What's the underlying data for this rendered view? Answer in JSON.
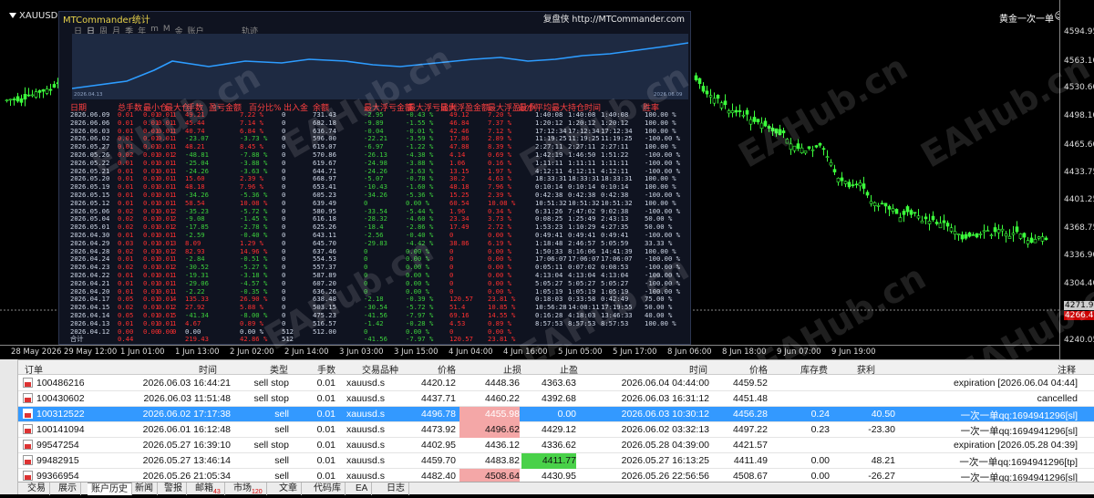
{
  "chart": {
    "symbol": "XAUUSD.s",
    "chart_name": "黄金一次一单",
    "prices": [
      "4594.95",
      "4563.10",
      "4530.60",
      "4498.10",
      "4465.60",
      "4433.75",
      "4401.25",
      "4368.75",
      "4336.90",
      "4304.40",
      "4266.45",
      "4240.05"
    ],
    "current_price": "4271.90",
    "bid_price": "4266.45",
    "times": [
      "28 May 2026",
      "29 May 12:00",
      "1 Jun 01:00",
      "1 Jun 13:00",
      "2 Jun 02:00",
      "2 Jun 14:00",
      "3 Jun 03:00",
      "3 Jun 15:00",
      "4 Jun 04:00",
      "4 Jun 16:00",
      "5 Jun 05:00",
      "5 Jun 17:00",
      "8 Jun 06:00",
      "8 Jun 18:00",
      "9 Jun 07:00",
      "9 Jun 19:00"
    ],
    "watermark": "EAHub.cn"
  },
  "panel": {
    "title": "MTCommander统计",
    "link": "复盘侠 http://MTCommander.com",
    "tabs": [
      "日",
      "日",
      "周",
      "月",
      "季",
      "年",
      "m",
      "M",
      "金",
      "账户"
    ],
    "track_label": "轨迹",
    "equity_start_date": "2026.04.13",
    "equity_end_date": "2026.06.09",
    "headers": [
      "日期",
      "总手数",
      "最小仓",
      "最大仓",
      "手数",
      "盈亏金额",
      "百分比%",
      "出入金",
      "余额",
      "最大浮亏金额",
      "最大浮亏比例",
      "最大浮盈金额",
      "最大浮盈比例",
      "最小平均最大持仓时间",
      "胜率"
    ],
    "rows": [
      [
        "2026.06.09",
        "0.01",
        "0.01",
        "0.01",
        "1",
        "49.21",
        "7.22 %",
        "0",
        "731.43",
        "-2.95",
        "-0.43 %",
        "49.12",
        "7.20 %",
        "1:40:08",
        "1:40:08",
        "1:40:08",
        "100.00 %"
      ],
      [
        "2026.06.06",
        "0.01",
        "0.01",
        "0.01",
        "1",
        "45.44",
        "7.14 %",
        "0",
        "682.18",
        "-9.89",
        "-1.55 %",
        "46.84",
        "7.37 %",
        "1:20:12",
        "1:20:12",
        "1:20:12",
        "100.00 %"
      ],
      [
        "2026.06.03",
        "0.01",
        "0.01",
        "0.01",
        "1",
        "40.74",
        "6.84 %",
        "0",
        "636.74",
        "-0.04",
        "-0.01 %",
        "42.46",
        "7.12 %",
        "17:12:34",
        "17:12:34",
        "17:12:34",
        "100.00 %"
      ],
      [
        "2026.06.02",
        "0.01",
        "0.01",
        "0.01",
        "1",
        "-23.07",
        "-3.73 %",
        "0",
        "596.00",
        "-22.21",
        "-3.59 %",
        "17.86",
        "2.89 %",
        "11:19:25",
        "11:19:25",
        "11:19:25",
        "-100.00 %"
      ],
      [
        "2026.05.27",
        "0.01",
        "0.01",
        "0.01",
        "1",
        "48.21",
        "8.45 %",
        "0",
        "619.07",
        "-6.97",
        "-1.22 %",
        "47.88",
        "8.39 %",
        "2:27:11",
        "2:27:11",
        "2:27:11",
        "100.00 %"
      ],
      [
        "2026.05.26",
        "0.02",
        "0.01",
        "0.01",
        "2",
        "-48.81",
        "-7.88 %",
        "0",
        "570.86",
        "-26.13",
        "-4.38 %",
        "4.14",
        "0.69 %",
        "1:42:19",
        "1:46:50",
        "1:51:22",
        "-100.00 %"
      ],
      [
        "2026.05.22",
        "0.01",
        "0.01",
        "0.01",
        "1",
        "-25.04",
        "-3.88 %",
        "0",
        "619.67",
        "-24.98",
        "-3.88 %",
        "1.06",
        "0.16 %",
        "1:11:11",
        "1:11:11",
        "1:11:11",
        "-100.00 %"
      ],
      [
        "2026.05.21",
        "0.01",
        "0.01",
        "0.01",
        "1",
        "-24.26",
        "-3.63 %",
        "0",
        "644.71",
        "-24.26",
        "-3.63 %",
        "13.15",
        "1.97 %",
        "4:12:11",
        "4:12:11",
        "4:12:11",
        "-100.00 %"
      ],
      [
        "2026.05.20",
        "0.01",
        "0.01",
        "0.01",
        "1",
        "15.60",
        "2.39 %",
        "0",
        "668.97",
        "-5.07",
        "-0.78 %",
        "30.2",
        "4.63 %",
        "18:33:31",
        "18:33:31",
        "18:33:31",
        "100.00 %"
      ],
      [
        "2026.05.19",
        "0.01",
        "0.01",
        "0.01",
        "1",
        "48.18",
        "7.96 %",
        "0",
        "653.41",
        "-10.43",
        "-1.60 %",
        "48.18",
        "7.96 %",
        "0:10:14",
        "0:10:14",
        "0:10:14",
        "100.00 %"
      ],
      [
        "2026.05.15",
        "0.01",
        "0.01",
        "0.01",
        "1",
        "-34.26",
        "-5.36 %",
        "0",
        "605.23",
        "-34.26",
        "-5.36 %",
        "15.25",
        "2.39 %",
        "0:42:38",
        "0:42:38",
        "0:42:38",
        "-100.00 %"
      ],
      [
        "2026.05.12",
        "0.01",
        "0.01",
        "0.01",
        "1",
        "58.54",
        "10.08 %",
        "0",
        "639.49",
        "0",
        "0.00 %",
        "60.54",
        "10.08 %",
        "10:51:32",
        "10:51:32",
        "10:51:32",
        "100.00 %"
      ],
      [
        "2026.05.06",
        "0.02",
        "0.01",
        "0.01",
        "2",
        "-35.23",
        "-5.72 %",
        "0",
        "580.95",
        "-33.54",
        "-5.44 %",
        "1.96",
        "0.34 %",
        "6:31:26",
        "7:47:02",
        "9:02:38",
        "-100.00 %"
      ],
      [
        "2026.05.04",
        "0.02",
        "0.01",
        "0.01",
        "2",
        "-9.08",
        "-1.45 %",
        "0",
        "616.18",
        "-28.32",
        "-4.60 %",
        "23.34",
        "3.73 %",
        "0:08:25",
        "1:25:49",
        "2:43:13",
        "50.00 %"
      ],
      [
        "2026.05.01",
        "0.02",
        "0.01",
        "0.01",
        "2",
        "-17.85",
        "-2.78 %",
        "0",
        "625.26",
        "-18.4",
        "-2.86 %",
        "17.49",
        "2.72 %",
        "1:53:23",
        "1:10:29",
        "4:27:35",
        "50.00 %"
      ],
      [
        "2026.04.30",
        "0.01",
        "0.01",
        "0.01",
        "1",
        "-2.59",
        "-0.40 %",
        "0",
        "643.11",
        "-2.56",
        "-0.40 %",
        "0",
        "0.00 %",
        "0:49:41",
        "0:49:41",
        "0:49:41",
        "-100.00 %"
      ],
      [
        "2026.04.29",
        "0.03",
        "0.01",
        "0.01",
        "3",
        "8.09",
        "1.29 %",
        "0",
        "645.70",
        "-29.83",
        "-4.42 %",
        "38.86",
        "6.19 %",
        "1:18:48",
        "2:46:57",
        "5:05:59",
        "33.33 %"
      ],
      [
        "2026.04.28",
        "0.02",
        "0.01",
        "0.01",
        "2",
        "82.93",
        "14.96 %",
        "0",
        "637.46",
        "0",
        "0.00 %",
        "0",
        "0.00 %",
        "1:50:33",
        "8:16:06",
        "14:41:39",
        "100.00 %"
      ],
      [
        "2026.04.24",
        "0.01",
        "0.01",
        "0.01",
        "1",
        "-2.84",
        "-0.51 %",
        "0",
        "554.53",
        "0",
        "0.00 %",
        "0",
        "0.00 %",
        "17:06:07",
        "17:06:07",
        "17:06:07",
        "-100.00 %"
      ],
      [
        "2026.04.23",
        "0.02",
        "0.01",
        "0.01",
        "2",
        "-30.52",
        "-5.27 %",
        "0",
        "557.37",
        "0",
        "0.00 %",
        "0",
        "0.00 %",
        "0:05:11",
        "0:07:02",
        "0:08:53",
        "-100.00 %"
      ],
      [
        "2026.04.22",
        "0.01",
        "0.01",
        "0.01",
        "1",
        "-19.31",
        "-3.18 %",
        "0",
        "587.89",
        "0",
        "0.00 %",
        "0",
        "0.00 %",
        "4:13:04",
        "4:13:04",
        "4:13:04",
        "-100.00 %"
      ],
      [
        "2026.04.21",
        "0.01",
        "0.01",
        "0.01",
        "1",
        "-29.06",
        "-4.57 %",
        "0",
        "607.20",
        "0",
        "0.00 %",
        "0",
        "0.00 %",
        "5:05:27",
        "5:05:27",
        "5:05:27",
        "-100.00 %"
      ],
      [
        "2026.04.20",
        "0.01",
        "0.01",
        "0.01",
        "1",
        "-2.22",
        "-0.35 %",
        "0",
        "636.26",
        "0",
        "0.00 %",
        "0",
        "0.00 %",
        "1:05:19",
        "1:05:19",
        "1:05:19",
        "-100.00 %"
      ],
      [
        "2026.04.17",
        "0.05",
        "0.01",
        "0.01",
        "4",
        "135.33",
        "26.90 %",
        "0",
        "638.48",
        "-2.18",
        "-0.39 %",
        "120.57",
        "23.81 %",
        "0:18:03",
        "0:33:58",
        "0:42:49",
        "75.00 %"
      ],
      [
        "2026.04.15",
        "0.02",
        "0.01",
        "0.01",
        "2",
        "27.92",
        "5.88 %",
        "0",
        "503.15",
        "-30.54",
        "-5.72 %",
        "51.4",
        "10.85 %",
        "10:56:28",
        "14:08:11",
        "17:19:55",
        "50.00 %"
      ],
      [
        "2026.04.14",
        "0.05",
        "0.01",
        "0.01",
        "5",
        "-41.34",
        "-8.00 %",
        "0",
        "475.23",
        "-41.56",
        "-7.97 %",
        "69.16",
        "14.55 %",
        "0:16:28",
        "4:18:03",
        "13:46:33",
        "40.00 %"
      ],
      [
        "2026.04.13",
        "0.01",
        "0.01",
        "0.01",
        "1",
        "4.67",
        "0.89 %",
        "0",
        "516.57",
        "-1.42",
        "-0.28 %",
        "4.53",
        "0.89 %",
        "8:57:53",
        "8:57:53",
        "8:57:53",
        "100.00 %"
      ],
      [
        "2026.04.12",
        "0.00",
        "0.00",
        "0.00",
        "0",
        "0.00",
        "0.00 %",
        "512",
        "512.00",
        "0",
        "0.00 %",
        "0",
        "0.00 %",
        "",
        "",
        "",
        ""
      ]
    ],
    "total": [
      "合计",
      "0.44",
      "",
      "",
      "",
      "219.43",
      "42.86 %",
      "512",
      "",
      "-41.56",
      "-7.97 %",
      "120.57",
      "23.81 %",
      "",
      "",
      "",
      ""
    ]
  },
  "orders": {
    "headers": [
      "订单",
      "时间",
      "类型",
      "手数",
      "交易品种",
      "价格",
      "止损",
      "止盈",
      "时间",
      "价格",
      "库存费",
      "获利",
      "注释"
    ],
    "rows": [
      {
        "id": "100486216",
        "time": "2026.06.03 16:44:21",
        "type": "sell stop",
        "volume": "0.01",
        "symbol": "xauusd.s",
        "price": "4420.12",
        "sl": "4448.36",
        "tp": "4363.63",
        "close_time": "2026.06.04 04:44:00",
        "close_price": "4459.52",
        "swap": "",
        "profit": "",
        "comment": "expiration [2026.06.04 04:44]"
      },
      {
        "id": "100430602",
        "time": "2026.06.03 11:51:48",
        "type": "sell stop",
        "volume": "0.01",
        "symbol": "xauusd.s",
        "price": "4437.71",
        "sl": "4460.22",
        "tp": "4392.68",
        "close_time": "2026.06.03 16:31:12",
        "close_price": "4451.48",
        "swap": "",
        "profit": "",
        "comment": "cancelled"
      },
      {
        "id": "100312522",
        "time": "2026.06.02 17:17:38",
        "type": "sell",
        "volume": "0.01",
        "symbol": "xauusd.s",
        "price": "4496.78",
        "sl": "4455.98",
        "tp": "0.00",
        "close_time": "2026.06.03 10:30:12",
        "close_price": "4456.28",
        "swap": "0.24",
        "profit": "40.50",
        "comment": "一次一单qq:1694941296[sl]"
      },
      {
        "id": "100141094",
        "time": "2026.06.01 16:12:48",
        "type": "sell",
        "volume": "0.01",
        "symbol": "xauusd.s",
        "price": "4473.92",
        "sl": "4496.62",
        "tp": "4429.12",
        "close_time": "2026.06.02 03:32:13",
        "close_price": "4497.22",
        "swap": "0.23",
        "profit": "-23.30",
        "comment": "一次一单qq:1694941296[sl]"
      },
      {
        "id": "99547254",
        "time": "2026.05.27 16:39:10",
        "type": "sell stop",
        "volume": "0.01",
        "symbol": "xauusd.s",
        "price": "4402.95",
        "sl": "4436.12",
        "tp": "4336.62",
        "close_time": "2026.05.28 04:39:00",
        "close_price": "4421.57",
        "swap": "",
        "profit": "",
        "comment": "expiration [2026.05.28 04:39]"
      },
      {
        "id": "99482915",
        "time": "2026.05.27 13:46:14",
        "type": "sell",
        "volume": "0.01",
        "symbol": "xauusd.s",
        "price": "4459.70",
        "sl": "4483.82",
        "tp": "4411.77",
        "close_time": "2026.05.27 16:13:25",
        "close_price": "4411.49",
        "swap": "0.00",
        "profit": "48.21",
        "comment": "一次一单qq:1694941296[tp]"
      },
      {
        "id": "99366954",
        "time": "2026.05.26 21:05:34",
        "type": "sell",
        "volume": "0.01",
        "symbol": "xauusd.s",
        "price": "4482.40",
        "sl": "4508.64",
        "tp": "4430.95",
        "close_time": "2026.05.26 22:56:56",
        "close_price": "4508.67",
        "swap": "0.00",
        "profit": "-26.27",
        "comment": "一次一单qq:1694941296[sl]"
      }
    ]
  },
  "tabs": [
    {
      "label": "交易",
      "badge": ""
    },
    {
      "label": "展示",
      "badge": ""
    },
    {
      "label": "账户历史",
      "badge": ""
    },
    {
      "label": "新闻",
      "badge": ""
    },
    {
      "label": "警报",
      "badge": ""
    },
    {
      "label": "邮箱",
      "badge": "43"
    },
    {
      "label": "市场",
      "badge": "120"
    },
    {
      "label": "文章",
      "badge": ""
    },
    {
      "label": "代码库",
      "badge": ""
    },
    {
      "label": "EA",
      "badge": ""
    },
    {
      "label": "日志",
      "badge": ""
    }
  ]
}
